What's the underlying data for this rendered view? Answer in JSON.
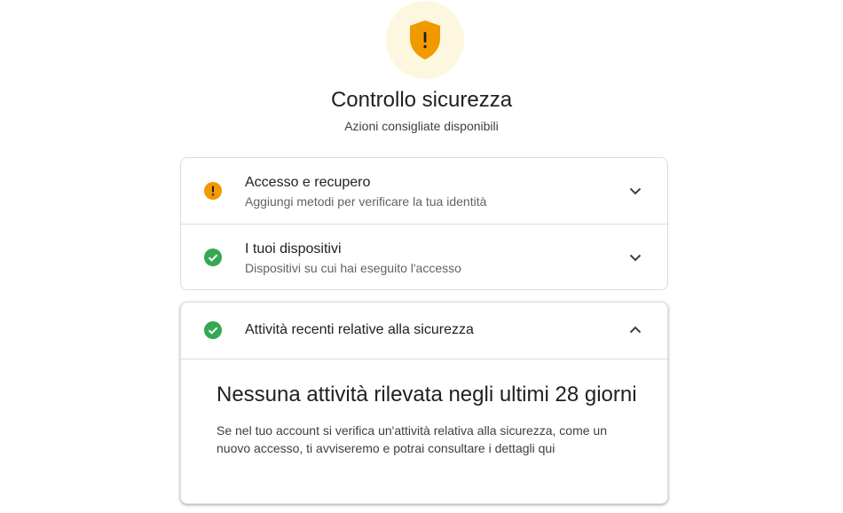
{
  "header": {
    "title": "Controllo sicurezza",
    "subtitle": "Azioni consigliate disponibili",
    "shield_icon": "shield-warning-icon",
    "shield_color": "#f29900",
    "shield_bg": "#fef7e0"
  },
  "sections": [
    {
      "title": "Accesso e recupero",
      "description": "Aggiungi metodi per verificare la tua identità",
      "status": "warning",
      "status_icon": "warning-circle-icon",
      "status_color": "#f29900",
      "expanded": false
    },
    {
      "title": "I tuoi dispositivi",
      "description": "Dispositivi su cui hai eseguito l'accesso",
      "status": "ok",
      "status_icon": "check-circle-icon",
      "status_color": "#34a853",
      "expanded": false
    }
  ],
  "activity": {
    "title": "Attività recenti relative alla sicurezza",
    "status": "ok",
    "status_icon": "check-circle-icon",
    "status_color": "#34a853",
    "expanded": true,
    "detail_title": "Nessuna attività rilevata negli ultimi 28 giorni",
    "detail_text": "Se nel tuo account si verifica un'attività relativa alla sicurezza, come un nuovo accesso, ti avviseremo e potrai consultare i dettagli qui"
  }
}
